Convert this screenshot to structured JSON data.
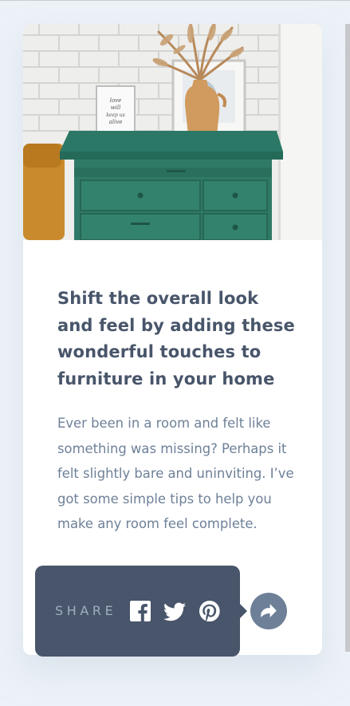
{
  "article": {
    "title": "Shift the overall look and feel by adding these wonderful touches to furniture in your home",
    "description": "Ever been in a room and felt like something was missing? Perhaps it felt slightly bare and uninviting. I’ve got some simple tips to help you make any room feel complete.",
    "image_frame_text": "love will keep us alive"
  },
  "share": {
    "label": "SHARE",
    "icons": [
      "facebook-icon",
      "twitter-icon",
      "pinterest-icon"
    ],
    "button_icon": "share-arrow-icon"
  },
  "colors": {
    "background": "#ecf2f8",
    "card": "#ffffff",
    "title": "#48556a",
    "body": "#6e8098",
    "popup": "#48556a",
    "share_label": "#9eafc2",
    "share_button": "#6e8098",
    "drawer_green": "#2f7a67"
  }
}
